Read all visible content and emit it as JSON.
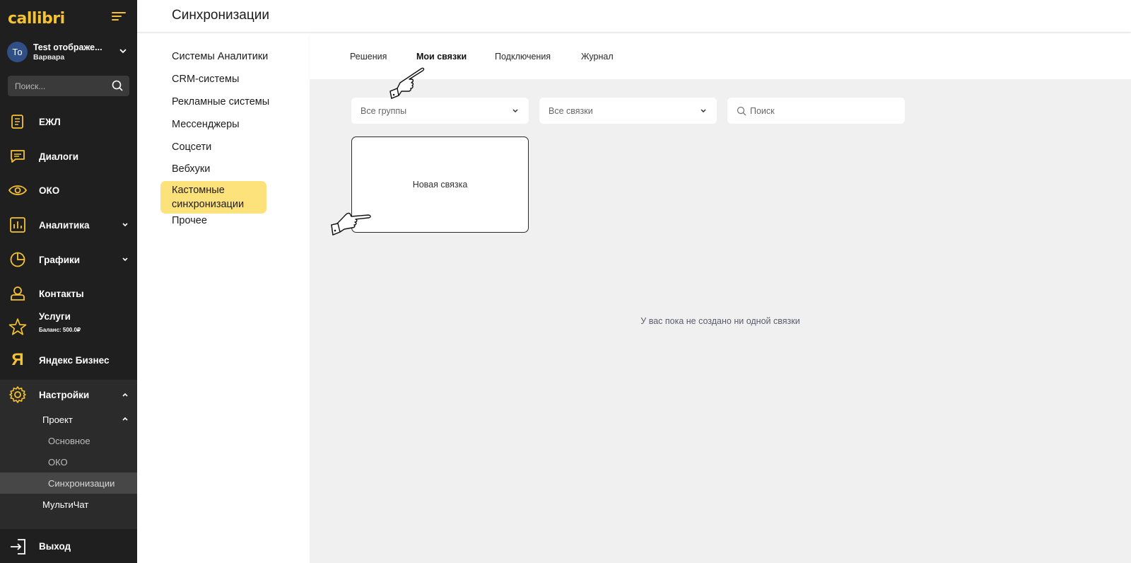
{
  "brand": {
    "name": "callibri"
  },
  "account": {
    "initials": "То",
    "project_name": "Test отображе...",
    "user_name": "Варвара"
  },
  "search": {
    "placeholder": "Поиск..."
  },
  "nav": {
    "items": [
      {
        "label": "ЕЖЛ",
        "icon": "journal-icon"
      },
      {
        "label": "Диалоги",
        "icon": "chat-icon"
      },
      {
        "label": "ОКО",
        "icon": "eye-icon"
      },
      {
        "label": "Аналитика",
        "icon": "bar-chart-icon"
      },
      {
        "label": "Графики",
        "icon": "pie-chart-icon"
      },
      {
        "label": "Контакты",
        "icon": "contact-icon"
      },
      {
        "label": "Услуги",
        "sub": "Баланс: 500.0₽",
        "icon": "star-icon"
      },
      {
        "label": "Яндекс Бизнес",
        "icon": "yandex-icon"
      },
      {
        "label": "Настройки",
        "icon": "gear-icon"
      }
    ],
    "settings_sub": {
      "project_label": "Проект",
      "project_items": [
        "Основное",
        "ОКО",
        "Синхронизации"
      ],
      "multichat_label": "МультиЧат"
    },
    "logout_label": "Выход"
  },
  "header": {
    "title": "Синхронизации"
  },
  "categories": [
    "Системы Аналитики",
    "CRM-системы",
    "Рекламные системы",
    "Мессенджеры",
    "Соцсети",
    "Вебхуки",
    "Кастомные синхронизации",
    "Прочее"
  ],
  "active_category": "Кастомные синхронизации",
  "tabs": [
    "Решения",
    "Мои связки",
    "Подключения",
    "Журнал"
  ],
  "active_tab": "Мои связки",
  "filters": {
    "groups_value": "Все группы",
    "links_value": "Все связки",
    "search_placeholder": "Поиск"
  },
  "new_card_label": "Новая связка",
  "empty_message": "У вас пока не создано ни одной связки",
  "colors": {
    "brand": "#f5c233",
    "sidebar_bg": "#1f1f1f",
    "active_category_bg": "#fde27c",
    "main_bg": "#f0f0f0"
  }
}
